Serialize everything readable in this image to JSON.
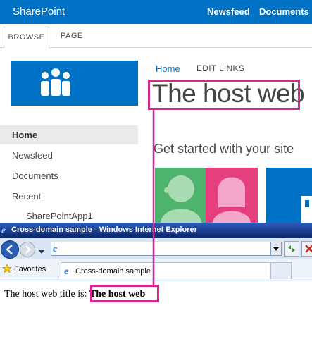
{
  "suite_bar": {
    "brand": "SharePoint",
    "links": [
      "Newsfeed",
      "Documents"
    ]
  },
  "ribbon": {
    "tabs": [
      "BROWSE",
      "PAGE"
    ]
  },
  "quick_launch": {
    "items": [
      "Home",
      "Newsfeed",
      "Documents",
      "Recent"
    ],
    "recent_items": [
      "SharePointApp1"
    ]
  },
  "top_links": [
    "Home",
    "EDIT LINKS"
  ],
  "page": {
    "title": "The host web",
    "get_started": "Get started with your site"
  },
  "ie": {
    "window_title": "Cross-domain sample - Windows Internet Explorer",
    "address_value": "",
    "favorites_label": "Favorites",
    "tab_label": "Cross-domain sample",
    "content": {
      "label": "The host web title is: ",
      "value": "The host web"
    }
  },
  "colors": {
    "accent": "#0072c6",
    "highlight": "#d7268f"
  }
}
